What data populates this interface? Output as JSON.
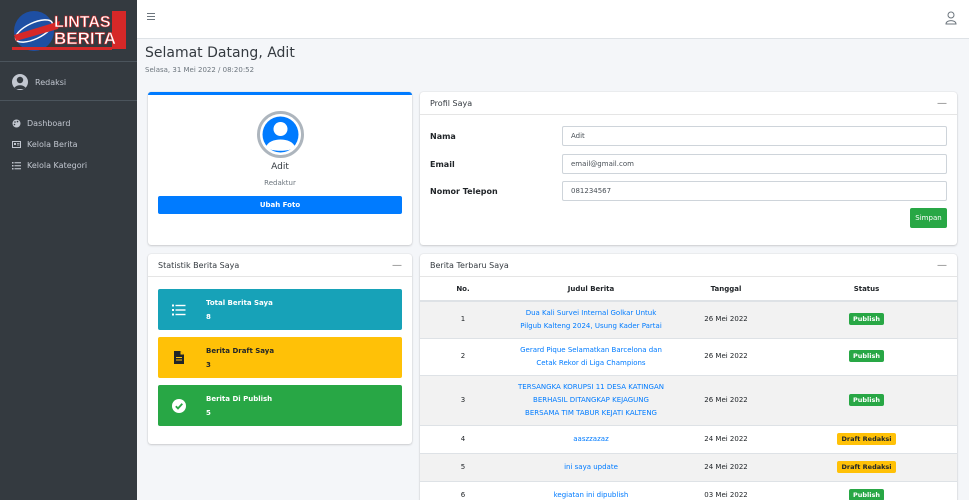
{
  "brand": {
    "logo_text_1": "LINTAS",
    "logo_text_2": "BERITA"
  },
  "sidebar": {
    "user": "Redaksi",
    "items": [
      {
        "label": "Dashboard",
        "icon": "palette-icon"
      },
      {
        "label": "Kelola Berita",
        "icon": "newspaper-icon"
      },
      {
        "label": "Kelola Kategori",
        "icon": "list-icon"
      }
    ]
  },
  "header": {
    "title": "Selamat Datang, Adit",
    "datetime": "Selasa, 31 Mei 2022 / 08:20:52"
  },
  "profile": {
    "name": "Adit",
    "role": "Redaktur",
    "change_photo": "Ubah Foto"
  },
  "profil_form": {
    "title": "Profil Saya",
    "collapse": "—",
    "fields": [
      {
        "label": "Nama",
        "value": "Adit"
      },
      {
        "label": "Email",
        "value": "email@gmail.com"
      },
      {
        "label": "Nomor Telepon",
        "value": "081234567"
      }
    ],
    "save": "Simpan"
  },
  "stats": {
    "title": "Statistik Berita Saya",
    "collapse": "—",
    "boxes": [
      {
        "label": "Total Berita Saya",
        "value": "8",
        "color": "#17a2b8",
        "icon": "list-icon"
      },
      {
        "label": "Berita Draft Saya",
        "value": "3",
        "color": "#ffc107",
        "icon": "file-icon"
      },
      {
        "label": "Berita Di Publish",
        "value": "5",
        "color": "#28a745",
        "icon": "check-circle-icon"
      }
    ]
  },
  "news": {
    "title": "Berita Terbaru Saya",
    "collapse": "—",
    "columns": [
      "No.",
      "Judul Berita",
      "Tanggal",
      "Status"
    ],
    "rows": [
      {
        "no": "1",
        "title": "Dua Kali Survei Internal Golkar Untuk Pilgub Kalteng 2024, Usung Kader Partai",
        "date": "26 Mei 2022",
        "status": "Publish"
      },
      {
        "no": "2",
        "title": "Gerard Pique Selamatkan Barcelona dan Cetak Rekor di Liga Champions",
        "date": "26 Mei 2022",
        "status": "Publish"
      },
      {
        "no": "3",
        "title": "TERSANGKA KORUPSI 11 DESA KATINGAN BERHASIL DITANGKAP KEJAGUNG BERSAMA TIM TABUR KEJATI KALTENG",
        "date": "26 Mei 2022",
        "status": "Publish"
      },
      {
        "no": "4",
        "title": "aaszzazaz",
        "date": "24 Mei 2022",
        "status": "Draft Redaksi"
      },
      {
        "no": "5",
        "title": "ini saya update",
        "date": "24 Mei 2022",
        "status": "Draft Redaksi"
      },
      {
        "no": "6",
        "title": "kegiatan ini dipublish",
        "date": "03 Mei 2022",
        "status": "Publish"
      }
    ]
  }
}
